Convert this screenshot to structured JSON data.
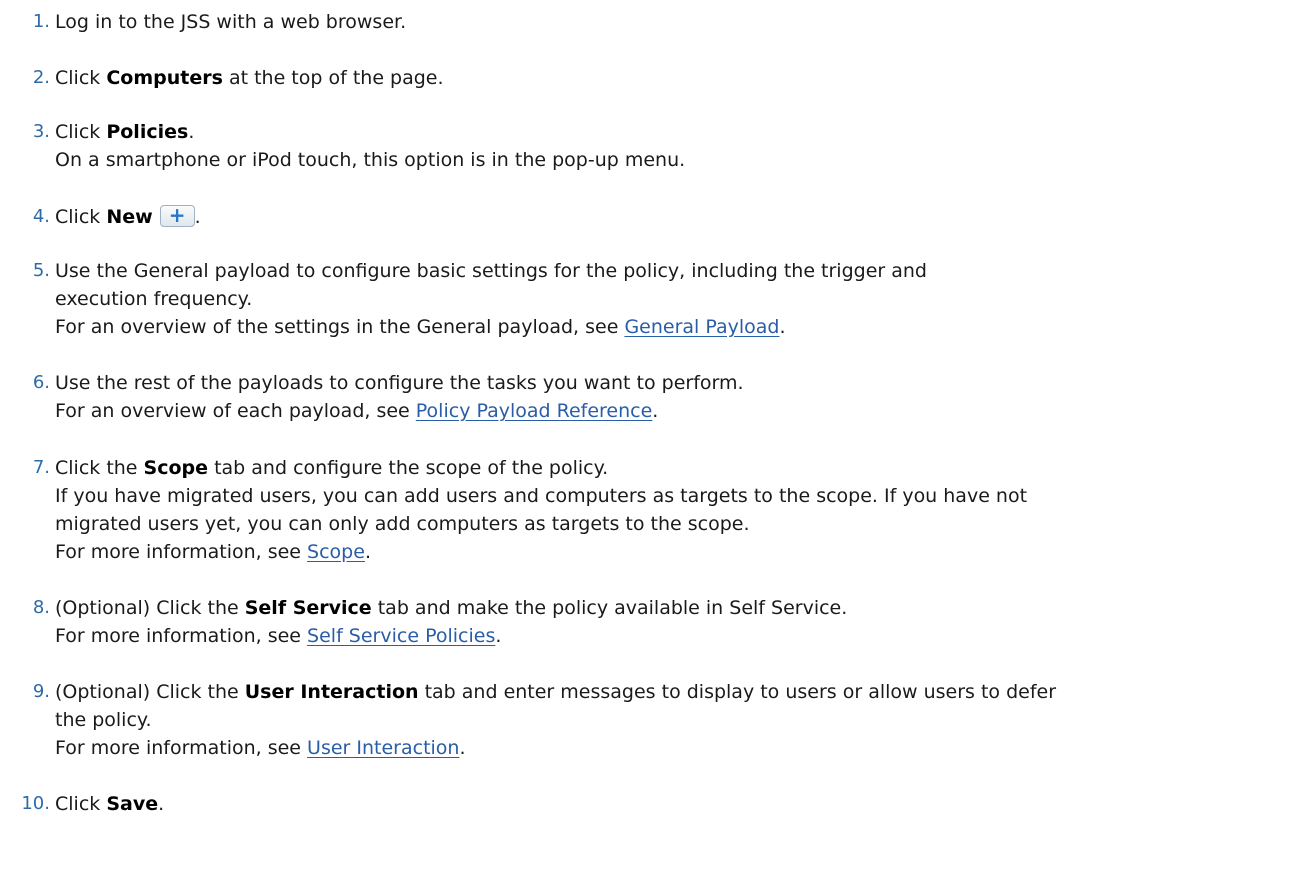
{
  "steps": [
    {
      "num": "1.",
      "pre": "Log in to the JSS with a web browser."
    },
    {
      "num": "2.",
      "pre": "Click ",
      "strong": "Computers",
      "post": " at the top of the page."
    },
    {
      "num": "3.",
      "pre": "Click ",
      "strong": "Policies",
      "post": ".",
      "note": "On a smartphone or iPod touch, this option is in the pop-up menu."
    },
    {
      "num": "4.",
      "pre": "Click ",
      "strong": "New",
      "post": ".",
      "icon": "plus-button-icon",
      "icon_glyph": "+"
    },
    {
      "num": "5.",
      "line1": "Use the General payload to configure basic settings for the policy, including the trigger and",
      "line2": "execution frequency.",
      "note_pre": "For an overview of the settings in the General payload, see ",
      "link": "General Payload",
      "note_post": "."
    },
    {
      "num": "6.",
      "line1": "Use the rest of the payloads to configure the tasks you want to perform.",
      "note_pre": "For an overview of each payload, see ",
      "link": "Policy Payload Reference",
      "note_post": "."
    },
    {
      "num": "7.",
      "pre": "Click the ",
      "strong": "Scope",
      "post": " tab and configure the scope of the policy.",
      "note1": "If you have migrated users, you can add users and computers as targets to the scope. If you have not",
      "note2": "migrated users yet, you can only add computers as targets to the scope.",
      "note_pre": "For more information, see ",
      "link": "Scope",
      "note_post": "."
    },
    {
      "num": "8.",
      "pre": "(Optional) Click the ",
      "strong": "Self Service",
      "post": " tab and make the policy available in Self Service.",
      "note_pre": "For more information, see ",
      "link": "Self Service Policies",
      "note_post": "."
    },
    {
      "num": "9.",
      "pre": "(Optional) Click the ",
      "strong": "User Interaction",
      "post": " tab and enter messages to display to users or allow users to defer",
      "line2": "the policy.",
      "note_pre": "For more information, see ",
      "link": "User Interaction",
      "note_post": "."
    },
    {
      "num": "10.",
      "pre": "Click ",
      "strong": "Save",
      "post": "."
    }
  ],
  "colors": {
    "number": "#2e6aa8",
    "link": "#2a5da8",
    "text": "#1a1a1a"
  }
}
